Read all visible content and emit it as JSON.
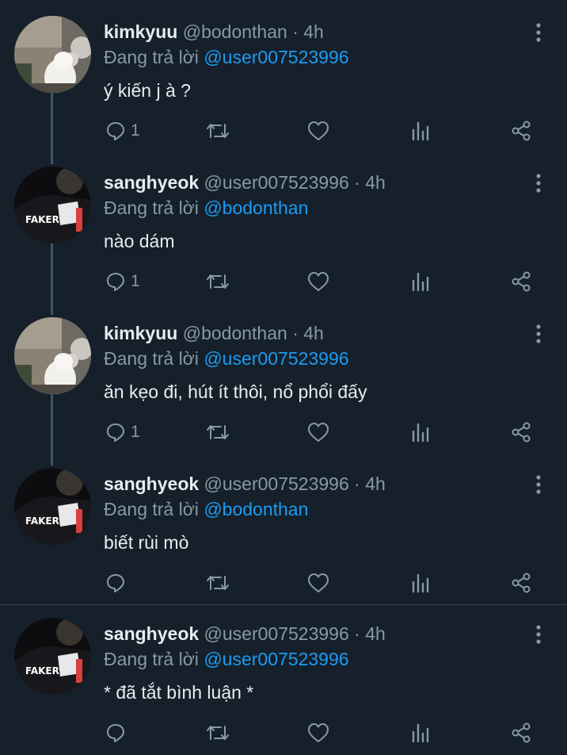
{
  "replying_label": "Đang trả lời",
  "dot": "·",
  "colors": {
    "background": "#15202b",
    "primary_text": "#e7ecf0",
    "secondary_text": "#8899a6",
    "mention": "#1d9bf0",
    "thread_line": "#3d5466"
  },
  "tweets": [
    {
      "name": "kimkyuu",
      "handle": "@bodonthan",
      "time": "4h",
      "reply_to": "@user007523996",
      "text": "ý kiến j à ?",
      "reply_count": "1",
      "avatar": "white-cat-avatar"
    },
    {
      "name": "sanghyeok",
      "handle": "@user007523996",
      "time": "4h",
      "reply_to": "@bodonthan",
      "text": "nào dám",
      "reply_count": "1",
      "avatar": "faker-jacket-avatar"
    },
    {
      "name": "kimkyuu",
      "handle": "@bodonthan",
      "time": "4h",
      "reply_to": "@user007523996",
      "text": "ăn kẹo đi, hút ít thôi, nổ phổi đấy",
      "reply_count": "1",
      "avatar": "white-cat-avatar"
    },
    {
      "name": "sanghyeok",
      "handle": "@user007523996",
      "time": "4h",
      "reply_to": "@bodonthan",
      "text": "biết rùi mò",
      "reply_count": "",
      "avatar": "faker-jacket-avatar"
    },
    {
      "name": "sanghyeok",
      "handle": "@user007523996",
      "time": "4h",
      "reply_to": "@user007523996",
      "text": "* đã tắt bình luận *",
      "reply_count": "",
      "avatar": "faker-jacket-avatar"
    }
  ]
}
